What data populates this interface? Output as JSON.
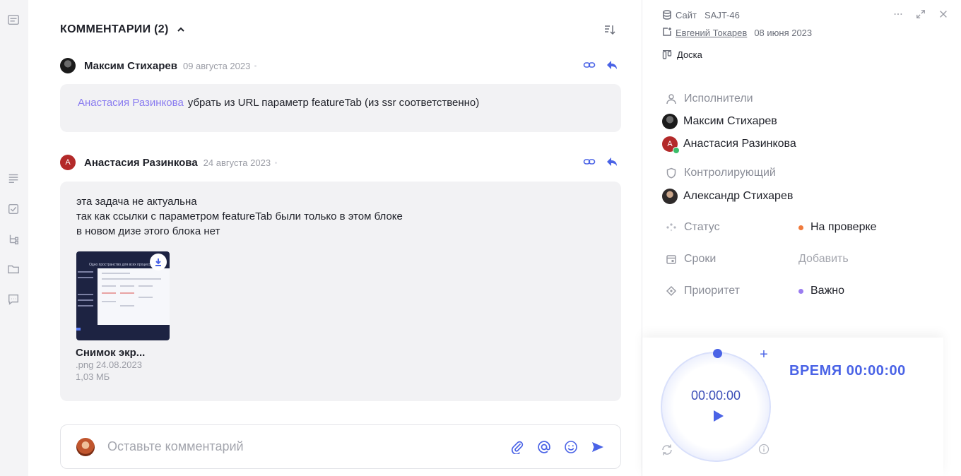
{
  "comments": {
    "title": "КОММЕНТАРИИ (2)",
    "items": [
      {
        "author": "Максим Стихарев",
        "date": "09 августа 2023",
        "mention": "Анастасия Разинкова",
        "text": "убрать из URL параметр featureTab (из ssr соответственно)"
      },
      {
        "author": "Анастасия Разинкова",
        "avatar_letter": "А",
        "date": "24 августа 2023",
        "lines": [
          "эта задача не актуальна",
          "так как ссылки с параметром featureTab были только в этом блоке",
          "в новом дизе этого блока нет"
        ],
        "attachment": {
          "thumb_title": "Одно пространство для всех процессов",
          "name": "Снимок экр...",
          "ext_date": ".png 24.08.2023",
          "size": "1,03 МБ"
        }
      }
    ],
    "composer_placeholder": "Оставьте комментарий"
  },
  "task": {
    "project": "Сайт",
    "key": "SAJT-46",
    "creator": "Евгений Токарев",
    "created": "08 июня 2023",
    "board": "Доска",
    "assignees_label": "Исполнители",
    "assignees": [
      "Максим Стихарев",
      "Анастасия Разинкова"
    ],
    "assignee_badge_letter": "А",
    "controller_label": "Контролирующий",
    "controller": "Александр Стихарев",
    "status_label": "Статус",
    "status_value": "На проверке",
    "status_color": "#f07a3c",
    "deadline_label": "Сроки",
    "deadline_value": "Добавить",
    "priority_label": "Приоритет",
    "priority_value": "Важно",
    "priority_color": "#9a7cf0"
  },
  "timer": {
    "display": "00:00:00",
    "label": "ВРЕМЯ 00:00:00",
    "accent": "#4a63e6"
  }
}
